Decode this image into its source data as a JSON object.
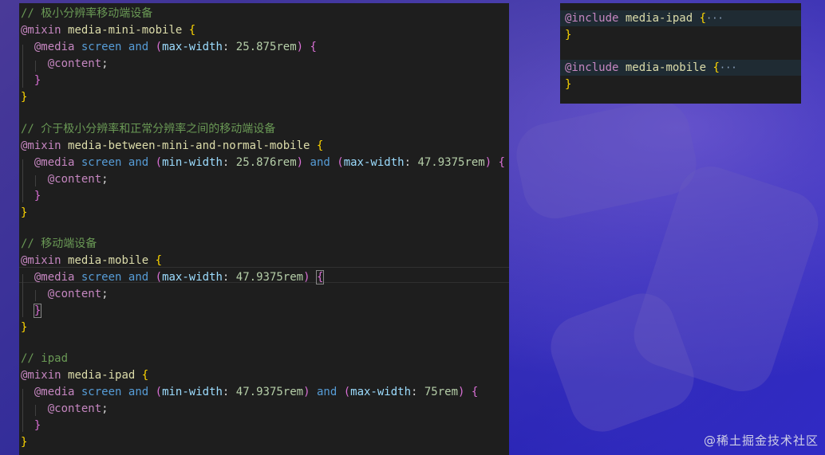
{
  "editor": {
    "lines": [
      {
        "comment": "// 极小分辨率移动端设备"
      },
      {
        "kw": "@mixin",
        "name": "media-mini-mobile",
        "open": "{"
      },
      {
        "at": "@media",
        "screen": "screen",
        "and1": "and",
        "p1": "(",
        "prop1": "max-width",
        "colon1": ":",
        "val1": "25.875rem",
        "cp1": ")",
        "open": "{"
      },
      {
        "content": "@content",
        "semi": ";"
      },
      {
        "close": "}"
      },
      {
        "close": "}"
      },
      {},
      {
        "comment": "// 介于极小分辨率和正常分辨率之间的移动端设备"
      },
      {
        "kw": "@mixin",
        "name": "media-between-mini-and-normal-mobile",
        "open": "{"
      },
      {
        "at": "@media",
        "screen": "screen",
        "and1": "and",
        "p1": "(",
        "prop1": "min-width",
        "colon1": ":",
        "val1": "25.876rem",
        "cp1": ")",
        "and2": "and",
        "p2": "(",
        "prop2": "max-width",
        "colon2": ":",
        "val2": "47.9375rem",
        "cp2": ")",
        "open": "{"
      },
      {
        "content": "@content",
        "semi": ";"
      },
      {
        "close": "}"
      },
      {
        "close": "}"
      },
      {},
      {
        "comment": "// 移动端设备"
      },
      {
        "kw": "@mixin",
        "name": "media-mobile",
        "open": "{"
      },
      {
        "at": "@media",
        "screen": "screen",
        "and1": "and",
        "p1": "(",
        "prop1": "max-width",
        "colon1": ":",
        "val1": "47.9375rem",
        "cp1": ")",
        "open": "{"
      },
      {
        "content": "@content",
        "semi": ";"
      },
      {
        "close": "}"
      },
      {
        "close": "}"
      },
      {},
      {
        "comment": "// ipad"
      },
      {
        "kw": "@mixin",
        "name": "media-ipad",
        "open": "{"
      },
      {
        "at": "@media",
        "screen": "screen",
        "and1": "and",
        "p1": "(",
        "prop1": "min-width",
        "colon1": ":",
        "val1": "47.9375rem",
        "cp1": ")",
        "and2": "and",
        "p2": "(",
        "prop2": "max-width",
        "colon2": ":",
        "val2": "75rem",
        "cp2": ")",
        "open": "{"
      },
      {
        "content": "@content",
        "semi": ";"
      },
      {
        "close": "}"
      },
      {
        "close": "}"
      }
    ]
  },
  "folded": {
    "lines": [
      {
        "kw": "@include",
        "name": "media-ipad",
        "open": "{",
        "ellipsis": "···"
      },
      {
        "close": "}"
      },
      {},
      {
        "kw": "@include",
        "name": "media-mobile",
        "open": "{",
        "ellipsis": "···"
      },
      {
        "close": "}"
      }
    ]
  },
  "watermark": "@稀土掘金技术社区"
}
